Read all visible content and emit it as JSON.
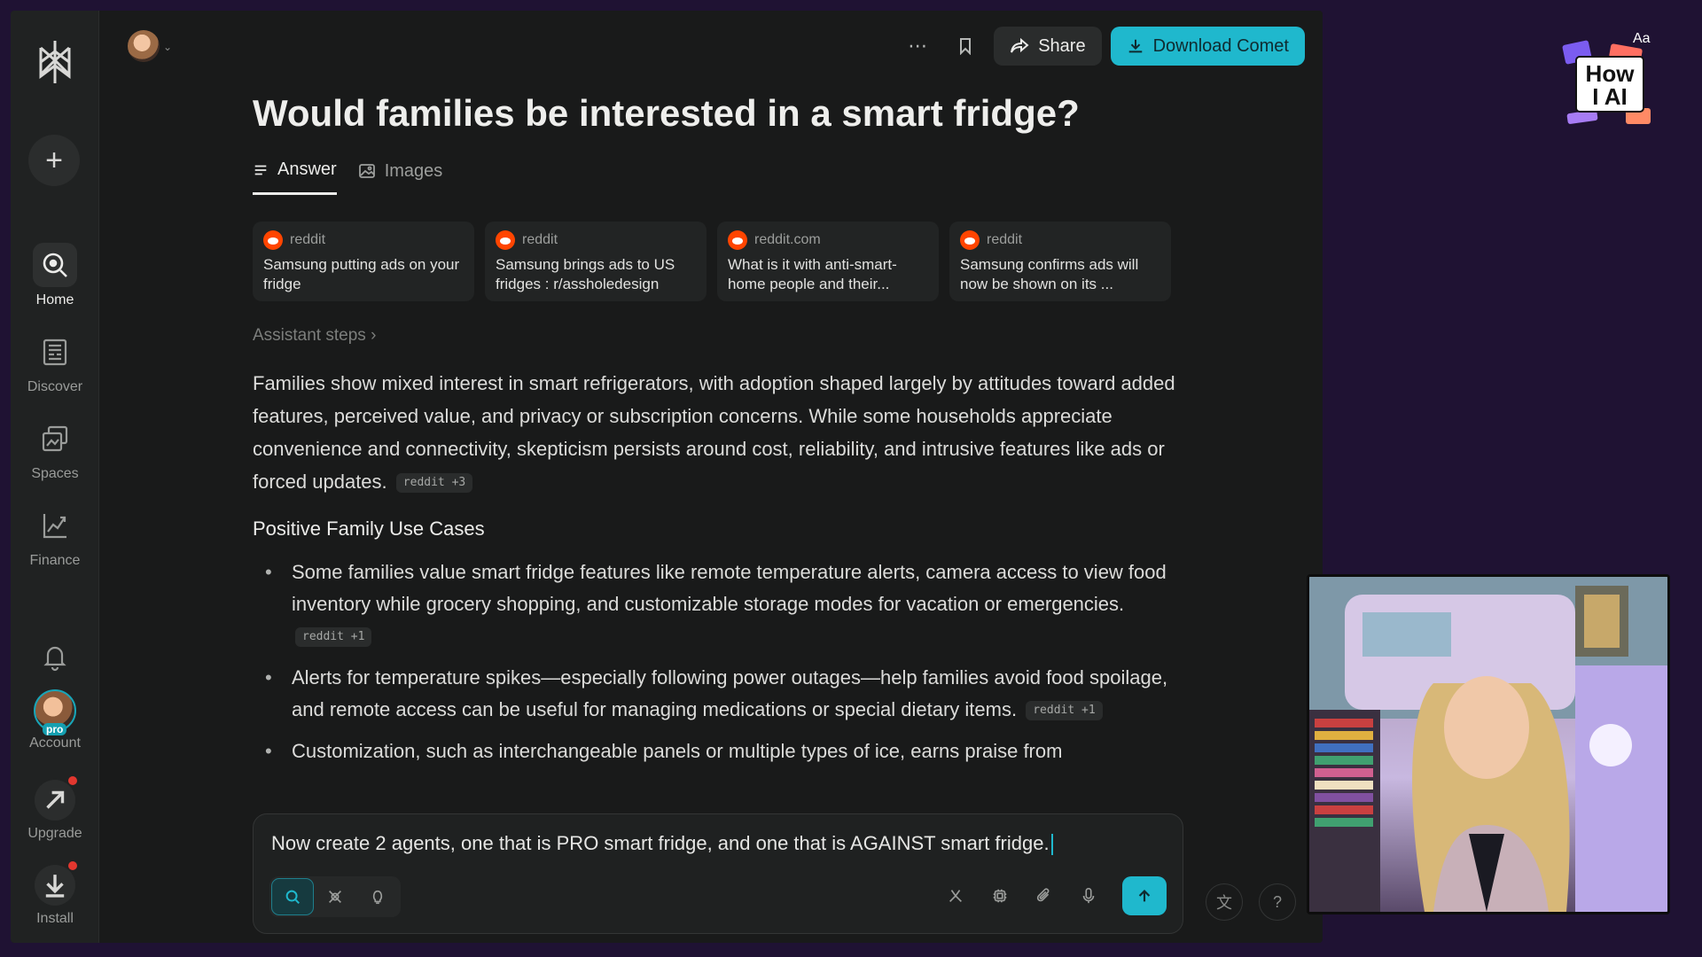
{
  "sidebar": {
    "items": [
      {
        "label": "Home",
        "icon": "search-icon"
      },
      {
        "label": "Discover",
        "icon": "newspaper-icon"
      },
      {
        "label": "Spaces",
        "icon": "spaces-icon"
      },
      {
        "label": "Finance",
        "icon": "chart-icon"
      }
    ],
    "account_label": "Account",
    "pro_badge": "pro",
    "upgrade_label": "Upgrade",
    "install_label": "Install"
  },
  "topbar": {
    "more_icon": "ellipsis-icon",
    "share_label": "Share",
    "download_label": "Download Comet",
    "accent": "#1fb8cd"
  },
  "thread": {
    "question": "Would families be interested in a smart fridge?",
    "tabs": [
      {
        "label": "Answer",
        "active": true
      },
      {
        "label": "Images",
        "active": false
      }
    ],
    "sources": [
      {
        "site": "reddit",
        "title": "Samsung putting ads on your fridge"
      },
      {
        "site": "reddit",
        "title": "Samsung brings ads to US fridges : r/assholedesign"
      },
      {
        "site": "reddit.com",
        "title": "What is it with anti-smart-home people and their..."
      },
      {
        "site": "reddit",
        "title": "Samsung confirms ads will now be shown on its ..."
      }
    ],
    "assistant_steps": "Assistant steps",
    "answer_paragraph": "Families show mixed interest in smart refrigerators, with adoption shaped largely by attitudes toward added features, perceived value, and privacy or subscription concerns. While some households appreciate convenience and connectivity, skepticism persists around cost, reliability, and intrusive features like ads or forced updates.",
    "answer_cite": "reddit +3",
    "section_heading": "Positive Family Use Cases",
    "bullets": [
      {
        "text": "Some families value smart fridge features like remote temperature alerts, camera access to view food inventory while grocery shopping, and customizable storage modes for vacation or emergencies.",
        "cite": "reddit +1"
      },
      {
        "text": "Alerts for temperature spikes—especially following power outages—help families avoid food spoilage, and remote access can be useful for managing medications or special dietary items.",
        "cite": "reddit +1"
      },
      {
        "text": "Customization, such as interchangeable panels or multiple types of ice, earns praise from",
        "cite": ""
      }
    ]
  },
  "composer": {
    "text": "Now create 2 agents, one that is PRO smart fridge, and one that is AGAINST smart fridge."
  },
  "overlay": {
    "logo_aa": "Aa",
    "logo_line1": "How",
    "logo_line2": "I AI"
  }
}
